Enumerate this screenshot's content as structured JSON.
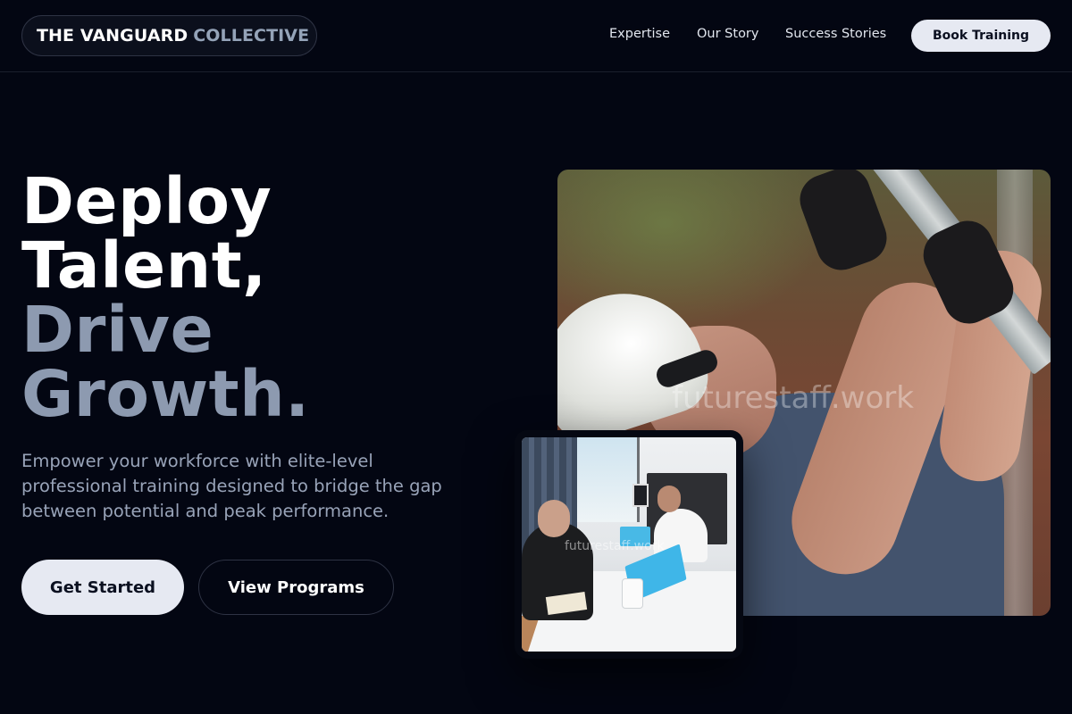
{
  "header": {
    "logo_primary": "THE VANGUARD",
    "logo_accent": "COLLECTIVE",
    "nav": [
      {
        "label": "Expertise"
      },
      {
        "label": "Our Story"
      },
      {
        "label": "Success Stories"
      }
    ],
    "cta_label": "Book Training"
  },
  "hero": {
    "headline_lines": [
      "Deploy",
      "Talent,",
      "Drive",
      "Growth."
    ],
    "subtext": "Empower your workforce with elite-level professional training designed to bridge the gap between potential and peak performance.",
    "primary_button": "Get Started",
    "secondary_button": "View Programs",
    "main_image_watermark": "futurestaff.work",
    "small_image_watermark": "futurestaff.work"
  },
  "colors": {
    "background": "#030612",
    "accent_grey": "#8d9ab0",
    "button_light": "#e6e9f2"
  }
}
